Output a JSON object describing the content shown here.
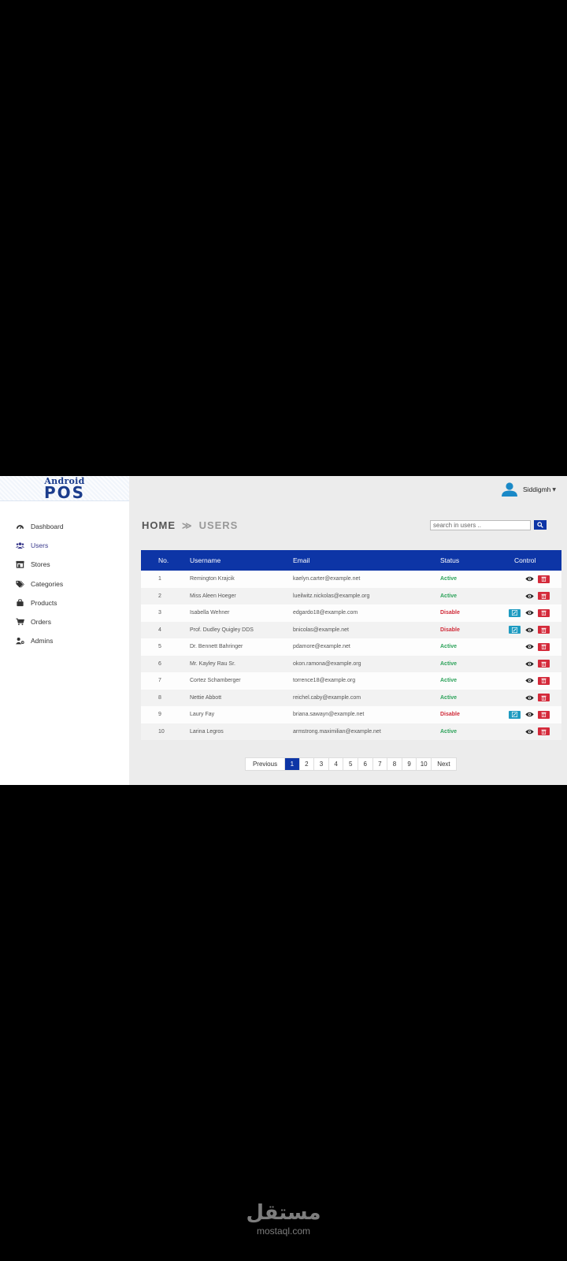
{
  "logo": {
    "top": "Android",
    "bottom": "POS"
  },
  "sidebar": {
    "items": [
      {
        "label": "Dashboard",
        "icon": "dashboard-icon"
      },
      {
        "label": "Users",
        "icon": "users-icon",
        "active": true
      },
      {
        "label": "Stores",
        "icon": "store-icon"
      },
      {
        "label": "Categories",
        "icon": "tags-icon"
      },
      {
        "label": "Products",
        "icon": "bag-icon"
      },
      {
        "label": "Orders",
        "icon": "cart-icon"
      },
      {
        "label": "Admins",
        "icon": "admin-icon"
      }
    ]
  },
  "user": {
    "name": "Siddigmh"
  },
  "breadcrumb": {
    "home": "HOME",
    "separator": "≫",
    "current": "USERS"
  },
  "search": {
    "placeholder": "search in users ..",
    "value": ""
  },
  "table": {
    "columns": [
      "No.",
      "Username",
      "Email",
      "Status",
      "Control"
    ],
    "rows": [
      {
        "no": "1",
        "username": "Remington Krajcik",
        "email": "kaelyn.carter@example.net",
        "status": "Active"
      },
      {
        "no": "2",
        "username": "Miss Aleen Hoeger",
        "email": "lueilwitz.nickolas@example.org",
        "status": "Active"
      },
      {
        "no": "3",
        "username": "Isabella Wehner",
        "email": "edgardo18@example.com",
        "status": "Disable"
      },
      {
        "no": "4",
        "username": "Prof. Dudley Quigley DDS",
        "email": "bnicolas@example.net",
        "status": "Disable"
      },
      {
        "no": "5",
        "username": "Dr. Bennett Bahringer",
        "email": "pdamore@example.net",
        "status": "Active"
      },
      {
        "no": "6",
        "username": "Mr. Kayley Rau Sr.",
        "email": "okon.ramona@example.org",
        "status": "Active"
      },
      {
        "no": "7",
        "username": "Cortez Schamberger",
        "email": "torrence18@example.org",
        "status": "Active"
      },
      {
        "no": "8",
        "username": "Nettie Abbott",
        "email": "reichel.caby@example.com",
        "status": "Active"
      },
      {
        "no": "9",
        "username": "Laury Fay",
        "email": "briana.sawayn@example.net",
        "status": "Disable"
      },
      {
        "no": "10",
        "username": "Larina Legros",
        "email": "armstrong.maximilian@example.net",
        "status": "Active"
      }
    ]
  },
  "pagination": {
    "previous": "Previous",
    "pages": [
      "1",
      "2",
      "3",
      "4",
      "5",
      "6",
      "7",
      "8",
      "9",
      "10"
    ],
    "current": "1",
    "next": "Next"
  },
  "watermark": {
    "arabic": "مستقل",
    "domain": "mostaql.com"
  },
  "colors": {
    "primary": "#0d35a6",
    "active": "#2ea35b",
    "disable": "#d02a38",
    "edit": "#1e9bc1",
    "delete": "#d42a3a"
  }
}
